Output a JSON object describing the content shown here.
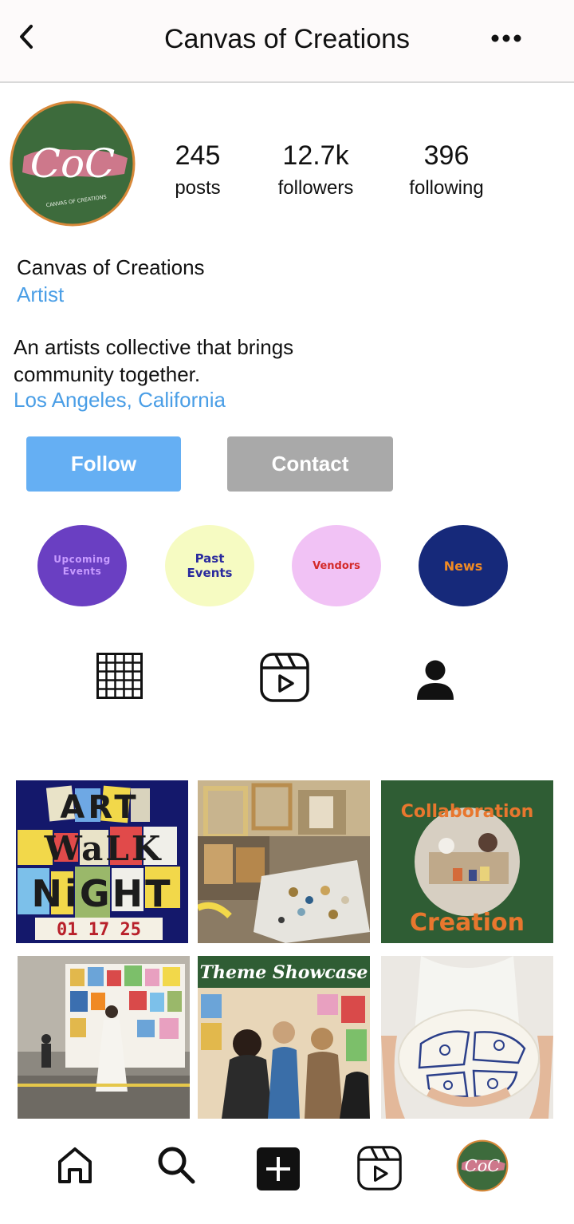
{
  "header": {
    "title": "Canvas of Creations",
    "back_icon": "chevron-left-icon",
    "more_icon": "more-horizontal-icon"
  },
  "profile": {
    "avatar_text": "CoC",
    "avatar_subtext": "CANVAS OF CREATIONS",
    "stats": [
      {
        "value": "245",
        "label": "posts"
      },
      {
        "value": "12.7k",
        "label": "followers"
      },
      {
        "value": "396",
        "label": "following"
      }
    ],
    "name": "Canvas of Creations",
    "category": "Artist",
    "bio_line1": "An artists collective that brings",
    "bio_line2": "community together.",
    "location": "Los Angeles, California"
  },
  "actions": {
    "follow_label": "Follow",
    "contact_label": "Contact"
  },
  "highlights": [
    {
      "label_line1": "Upcoming",
      "label_line2": "Events",
      "bg": "#6a3fc2",
      "fg": "#c79bff"
    },
    {
      "label_line1": "Past",
      "label_line2": "Events",
      "bg": "#f6fbc2",
      "fg": "#2a2a9e"
    },
    {
      "label_line1": "Vendors",
      "label_line2": "",
      "bg": "#f1c2f5",
      "fg": "#d42a2a"
    },
    {
      "label_line1": "News",
      "label_line2": "",
      "bg": "#16297a",
      "fg": "#f08a24"
    }
  ],
  "tabs": [
    "grid-icon",
    "reels-icon",
    "tagged-user-icon"
  ],
  "posts": {
    "art_walk": {
      "line1": "ART",
      "line2": "WaLK",
      "line3": "NiGHT",
      "date": "01 17 25"
    },
    "collab": {
      "top": "Collaboration",
      "bottom": "Creation"
    },
    "theme": {
      "banner": "Theme Showcase"
    }
  },
  "bottom_nav": [
    "home-icon",
    "search-icon",
    "add-post-icon",
    "reels-icon",
    "profile-avatar-icon"
  ],
  "colors": {
    "link_blue": "#4a9ee6",
    "follow_blue": "#65aff3",
    "contact_gray": "#a9a9a9",
    "brand_green": "#3d6b3c",
    "brand_pink": "#d97a92",
    "brand_orange": "#d8893a"
  }
}
